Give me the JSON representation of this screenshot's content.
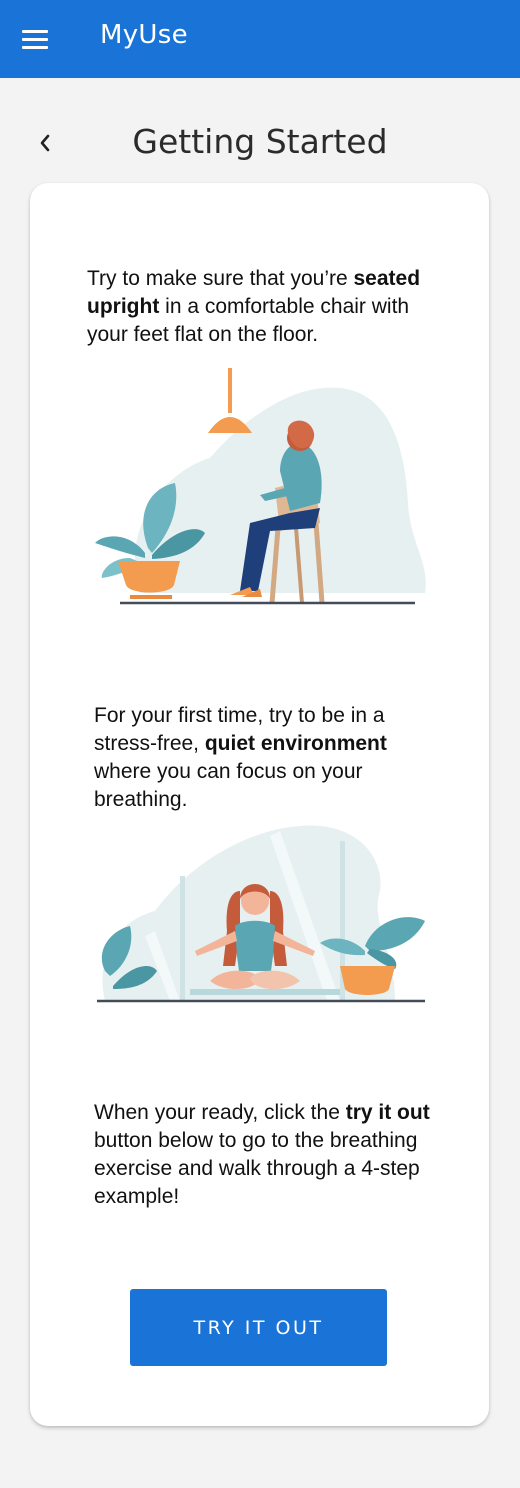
{
  "appbar": {
    "title": "MyUse",
    "menu_icon": "hamburger-menu-icon"
  },
  "header": {
    "title": "Getting Started",
    "back_icon": "chevron-left-icon"
  },
  "sections": [
    {
      "text_parts": [
        "Try to make sure that you’re ",
        "seated upright",
        " in a comfortable chair with your feet flat on the floor."
      ],
      "illustration": "woman-seated-on-chair-illustration"
    },
    {
      "text_parts": [
        "For your first time, try to be in a stress-free, ",
        "quiet environment",
        " where you can focus on your breathing."
      ],
      "illustration": "woman-meditating-illustration"
    },
    {
      "text_parts": [
        "When your ready, click the ",
        "try it out",
        " button below to go to the breathing exercise and walk through a 4-step example!"
      ]
    }
  ],
  "button": {
    "label": "TRY IT OUT"
  },
  "colors": {
    "primary": "#1a73d6",
    "background": "#f3f3f3",
    "accent_orange": "#f39b4e",
    "accent_teal": "#5aa7b3"
  }
}
